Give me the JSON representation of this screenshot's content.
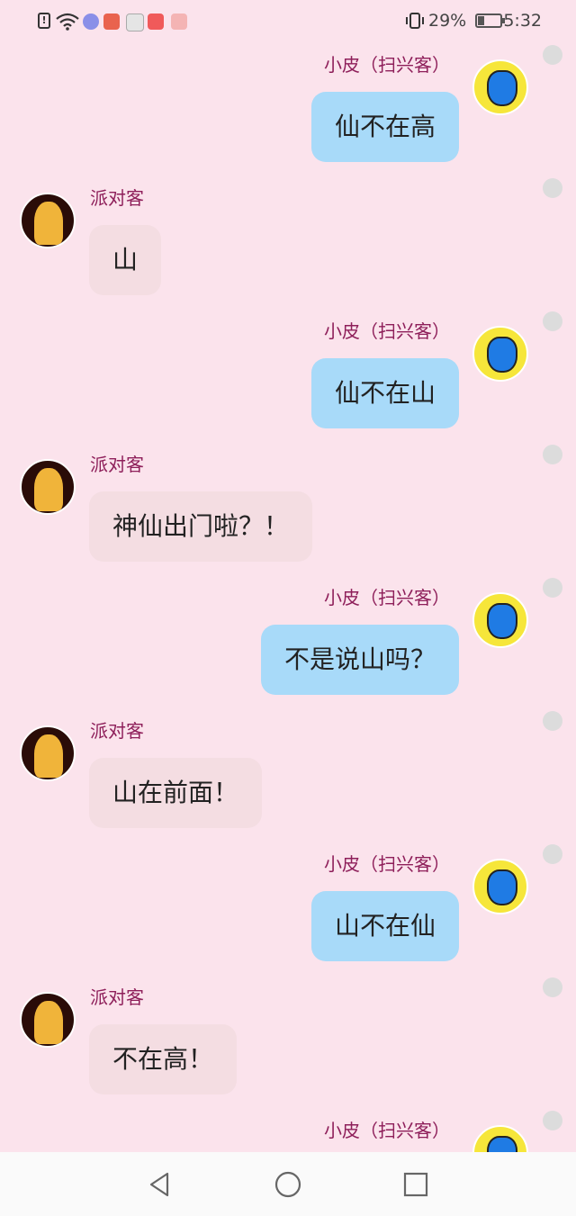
{
  "status_bar": {
    "battery_percent": "29%",
    "battery_level": 0.29,
    "time": "5:32",
    "icons": [
      "alert-icon",
      "wifi-icon",
      "music-app-icon",
      "app-icon",
      "app-icon",
      "app-icon",
      "app-icon",
      "vibrate-icon",
      "battery-icon"
    ]
  },
  "colors": {
    "background": "#fbe3ec",
    "outgoing_bubble": "#a8daf9",
    "incoming_bubble": "#f4dde2",
    "name_text": "#8e1f5a"
  },
  "messages": [
    {
      "side": "right",
      "sender": "小皮（扫兴客）",
      "text": "仙不在高"
    },
    {
      "side": "left",
      "sender": "派对客",
      "text": "山"
    },
    {
      "side": "right",
      "sender": "小皮（扫兴客）",
      "text": "仙不在山"
    },
    {
      "side": "left",
      "sender": "派对客",
      "text": "神仙出门啦？！"
    },
    {
      "side": "right",
      "sender": "小皮（扫兴客）",
      "text": "不是说山吗？"
    },
    {
      "side": "left",
      "sender": "派对客",
      "text": "山在前面！"
    },
    {
      "side": "right",
      "sender": "小皮（扫兴客）",
      "text": "山不在仙"
    },
    {
      "side": "left",
      "sender": "派对客",
      "text": "不在高！"
    },
    {
      "side": "right",
      "sender": "小皮（扫兴客）",
      "text": ""
    }
  ],
  "nav": {
    "buttons": [
      "back-icon",
      "home-icon",
      "recents-icon"
    ]
  }
}
